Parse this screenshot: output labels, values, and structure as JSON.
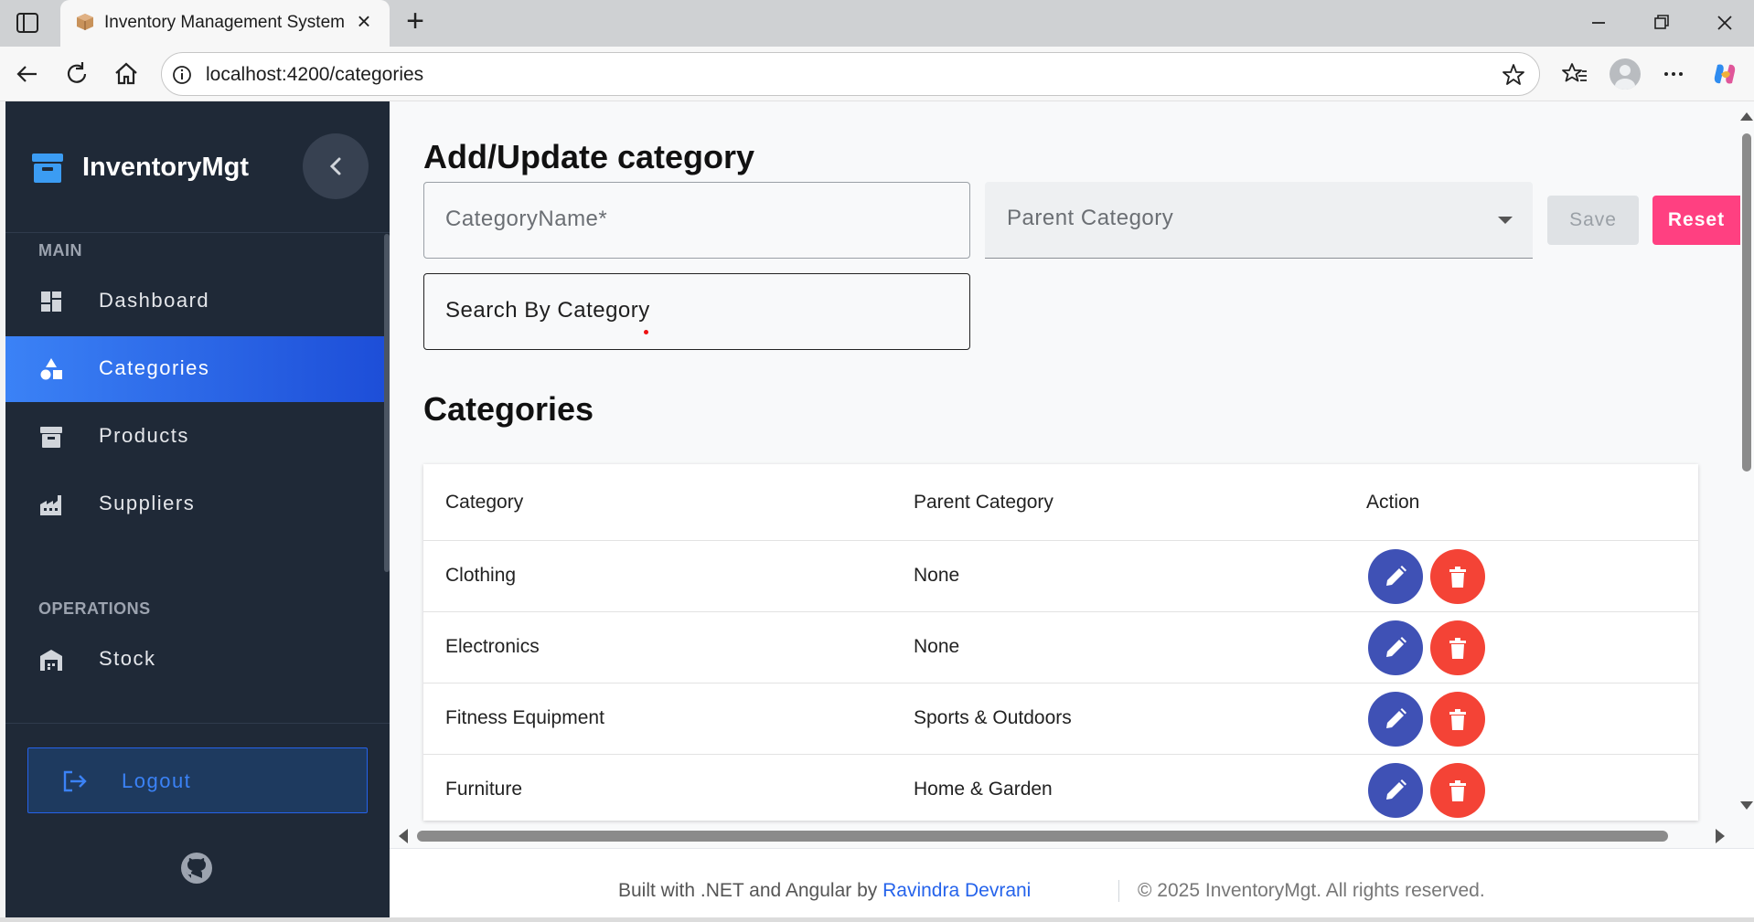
{
  "browser": {
    "tab_title": "Inventory Management System",
    "url": "localhost:4200/categories"
  },
  "sidebar": {
    "brand": "InventoryMgt",
    "sections": [
      {
        "title": "MAIN"
      },
      {
        "title": "OPERATIONS"
      }
    ],
    "items": [
      {
        "label": "Dashboard",
        "icon": "dashboard-icon"
      },
      {
        "label": "Categories",
        "icon": "category-icon",
        "active": true
      },
      {
        "label": "Products",
        "icon": "archive-icon"
      },
      {
        "label": "Suppliers",
        "icon": "factory-icon"
      },
      {
        "label": "Stock",
        "icon": "warehouse-icon"
      }
    ],
    "logout_label": "Logout"
  },
  "form": {
    "heading": "Add/Update category",
    "category_name_placeholder": "CategoryName*",
    "parent_category_placeholder": "Parent Category",
    "save_label": "Save",
    "reset_label": "Reset",
    "search_placeholder": "Search By Category"
  },
  "table": {
    "heading": "Categories",
    "columns": [
      "Category",
      "Parent Category",
      "Action"
    ],
    "rows": [
      {
        "category": "Clothing",
        "parent": "None"
      },
      {
        "category": "Electronics",
        "parent": "None"
      },
      {
        "category": "Fitness Equipment",
        "parent": "Sports & Outdoors"
      },
      {
        "category": "Furniture",
        "parent": "Home & Garden"
      }
    ]
  },
  "footer": {
    "built_with": "Built with .NET and Angular by",
    "author": "Ravindra Devrani",
    "copyright": "© 2025 InventoryMgt. All rights reserved."
  },
  "colors": {
    "sidebar_bg": "#1f2937",
    "active_item": "#3b82f6",
    "edit_button": "#3f51b5",
    "delete_button": "#f44336",
    "reset_button": "#ff4081"
  }
}
